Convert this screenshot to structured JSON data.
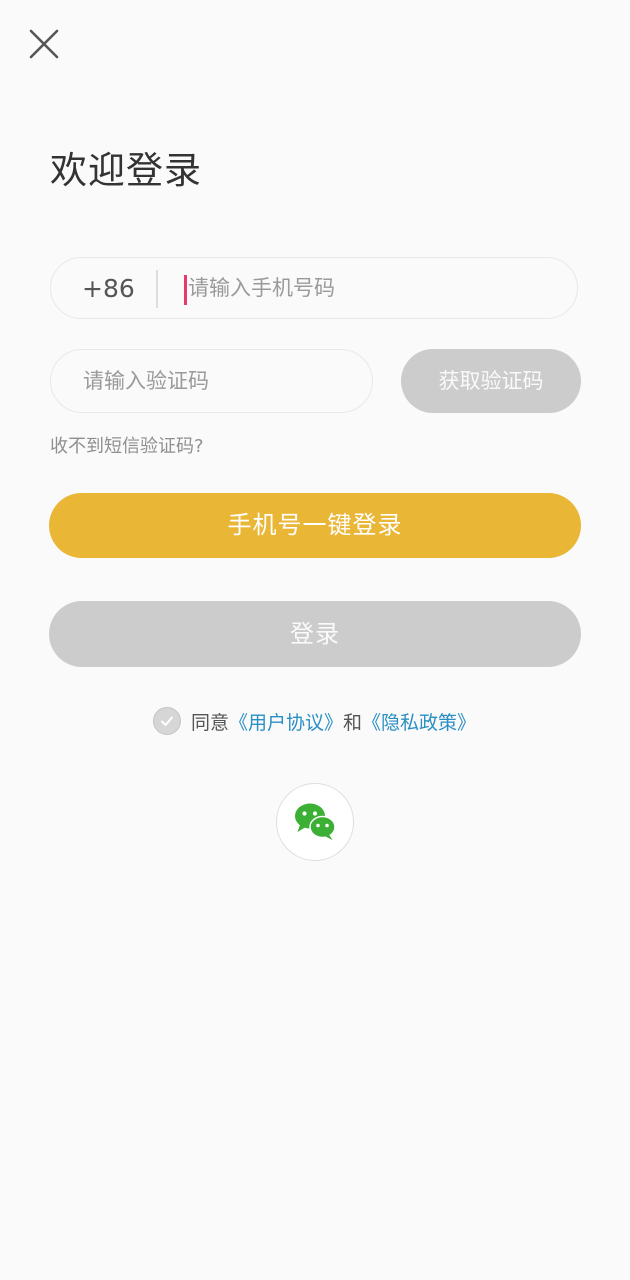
{
  "header": {
    "close_icon": "close-icon",
    "title": "欢迎登录"
  },
  "phone": {
    "country_code": "+86",
    "value": "",
    "placeholder": "请输入手机号码"
  },
  "verification": {
    "value": "",
    "placeholder": "请输入验证码",
    "get_code_label": "获取验证码",
    "no_sms_link": "收不到短信验证码?"
  },
  "actions": {
    "one_click_login_label": "手机号一键登录",
    "login_label": "登录"
  },
  "agreement": {
    "checked": false,
    "prefix": "同意",
    "user_agreement": "《用户协议》",
    "conjunction": "和",
    "privacy_policy": "《隐私政策》"
  },
  "social": {
    "wechat_icon": "wechat-icon"
  },
  "colors": {
    "background": "#fafafa",
    "primary_button": "#e9b636",
    "disabled_button": "#cccccc",
    "link": "#2a8fc4",
    "caret": "#e8396b",
    "wechat_green": "#3cb034"
  }
}
